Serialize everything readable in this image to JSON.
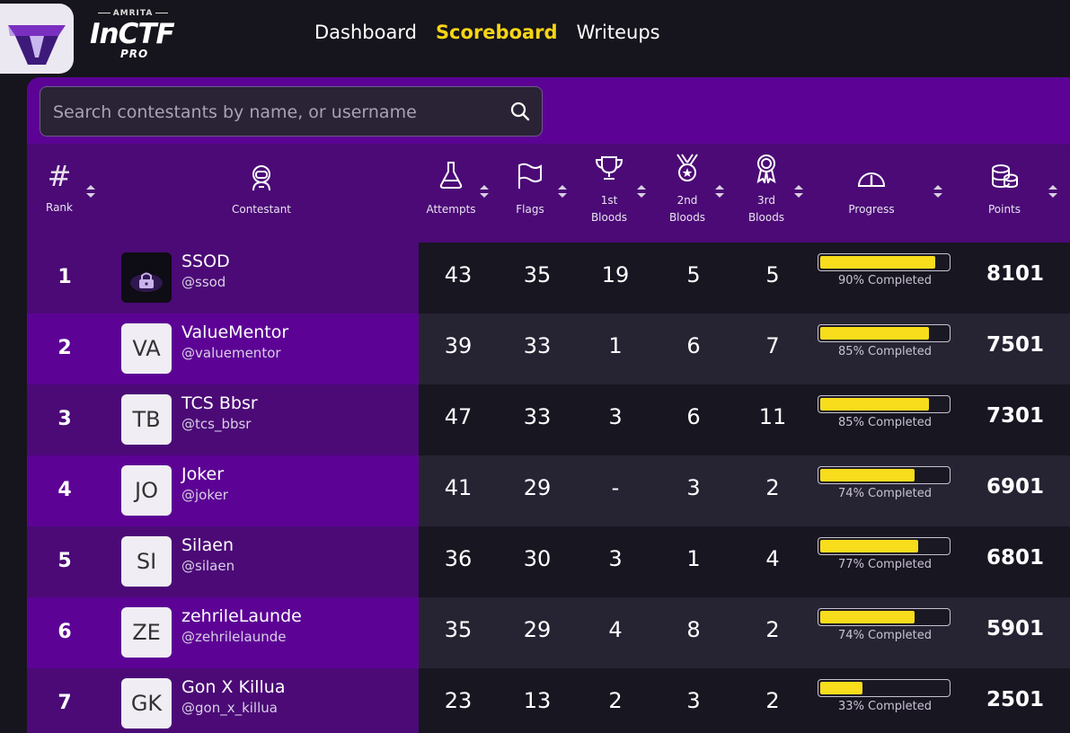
{
  "brand": {
    "amrita": "AMRITA",
    "name": "InCTF",
    "pro": "PRO"
  },
  "nav": [
    {
      "label": "Dashboard",
      "active": false
    },
    {
      "label": "Scoreboard",
      "active": true
    },
    {
      "label": "Writeups",
      "active": false
    }
  ],
  "search": {
    "placeholder": "Search contestants by name, or username"
  },
  "columns": {
    "rank": {
      "symbol": "#",
      "label": "Rank"
    },
    "contestant": {
      "label": "Contestant"
    },
    "attempts": {
      "label": "Attempts"
    },
    "flags": {
      "label": "Flags"
    },
    "first_bloods": {
      "label1": "1st",
      "label2": "Bloods"
    },
    "second_bloods": {
      "label1": "2nd",
      "label2": "Bloods"
    },
    "third_bloods": {
      "label1": "3rd",
      "label2": "Bloods"
    },
    "progress": {
      "label": "Progress"
    },
    "points": {
      "label": "Points"
    }
  },
  "rows": [
    {
      "rank": "1",
      "initials": "",
      "name": "SSOD",
      "username": "@ssod",
      "attempts": "43",
      "flags": "35",
      "first": "19",
      "second": "5",
      "third": "5",
      "progress": 0.9,
      "progress_text": "90% Completed",
      "points": "8101"
    },
    {
      "rank": "2",
      "initials": "VA",
      "name": "ValueMentor",
      "username": "@valuementor",
      "attempts": "39",
      "flags": "33",
      "first": "1",
      "second": "6",
      "third": "7",
      "progress": 0.85,
      "progress_text": "85% Completed",
      "points": "7501"
    },
    {
      "rank": "3",
      "initials": "TB",
      "name": "TCS Bbsr",
      "username": "@tcs_bbsr",
      "attempts": "47",
      "flags": "33",
      "first": "3",
      "second": "6",
      "third": "11",
      "progress": 0.85,
      "progress_text": "85% Completed",
      "points": "7301"
    },
    {
      "rank": "4",
      "initials": "JO",
      "name": "Joker",
      "username": "@joker",
      "attempts": "41",
      "flags": "29",
      "first": "-",
      "second": "3",
      "third": "2",
      "progress": 0.74,
      "progress_text": "74% Completed",
      "points": "6901"
    },
    {
      "rank": "5",
      "initials": "SI",
      "name": "Silaen",
      "username": "@silaen",
      "attempts": "36",
      "flags": "30",
      "first": "3",
      "second": "1",
      "third": "4",
      "progress": 0.77,
      "progress_text": "77% Completed",
      "points": "6801"
    },
    {
      "rank": "6",
      "initials": "ZE",
      "name": "zehrileLaunde",
      "username": "@zehrilelaunde",
      "attempts": "35",
      "flags": "29",
      "first": "4",
      "second": "8",
      "third": "2",
      "progress": 0.74,
      "progress_text": "74% Completed",
      "points": "5901"
    },
    {
      "rank": "7",
      "initials": "GK",
      "name": "Gon X Killua",
      "username": "@gon_x_killua",
      "attempts": "23",
      "flags": "13",
      "first": "2",
      "second": "3",
      "third": "2",
      "progress": 0.33,
      "progress_text": "33% Completed",
      "points": "2501"
    }
  ],
  "colors": {
    "accent": "#f7d515",
    "panel": "#5c0395",
    "progress": "#f7dd1b"
  }
}
